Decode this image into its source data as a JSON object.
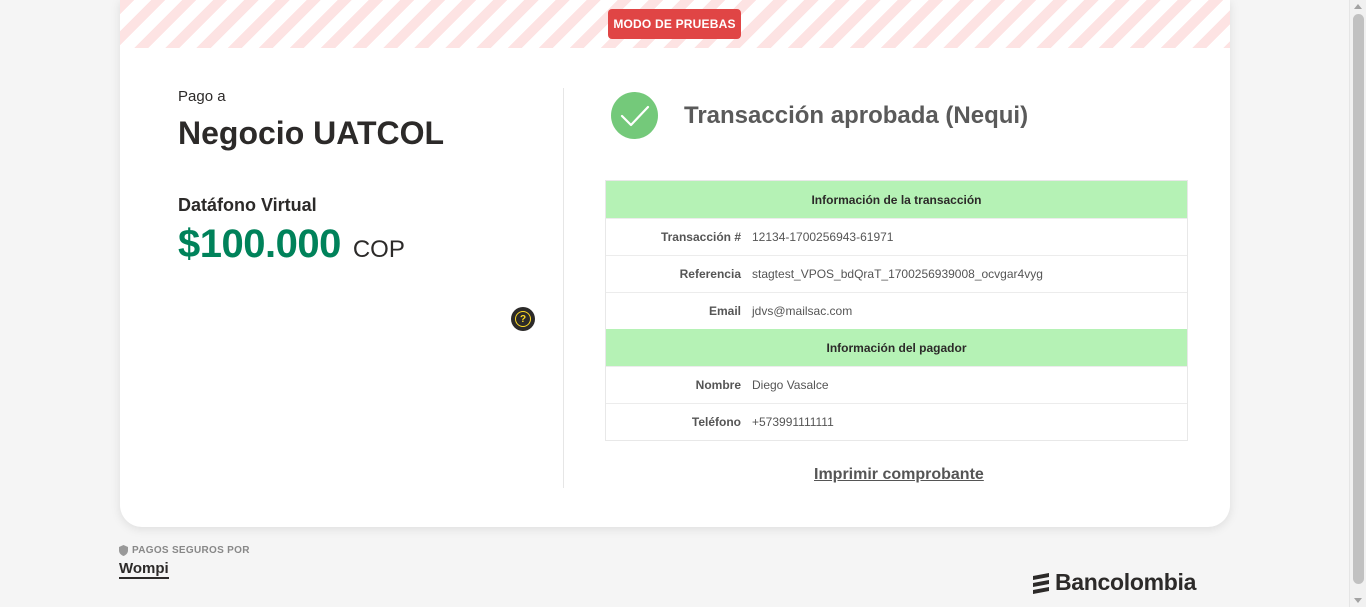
{
  "banner": {
    "badge": "MODO DE PRUEBAS"
  },
  "merchant": {
    "pay_to_label": "Pago a",
    "name": "Negocio UATCOL",
    "product": "Datáfono Virtual",
    "amount": "$100.000",
    "currency": "COP"
  },
  "status": {
    "text": "Transacción aprobada (Nequi)",
    "icon": "check-icon",
    "color": "#74c97a"
  },
  "transaction": {
    "section_title": "Información de la transacción",
    "rows": [
      {
        "label": "Transacción #",
        "value": "12134-1700256943-61971"
      },
      {
        "label": "Referencia",
        "value": "stagtest_VPOS_bdQraT_1700256939008_ocvgar4vyg"
      },
      {
        "label": "Email",
        "value": "jdvs@mailsac.com"
      }
    ]
  },
  "payer": {
    "section_title": "Información del pagador",
    "rows": [
      {
        "label": "Nombre",
        "value": "Diego Vasalce"
      },
      {
        "label": "Teléfono",
        "value": "+573991111111"
      }
    ]
  },
  "actions": {
    "print_label": "Imprimir comprobante"
  },
  "footer": {
    "secure_label": "PAGOS SEGUROS POR",
    "wompi": "Wompi",
    "bank": "Bancolombia"
  },
  "colors": {
    "accent_green": "#00825a",
    "section_bg": "#b5f2b5",
    "badge_red": "#e04545"
  }
}
